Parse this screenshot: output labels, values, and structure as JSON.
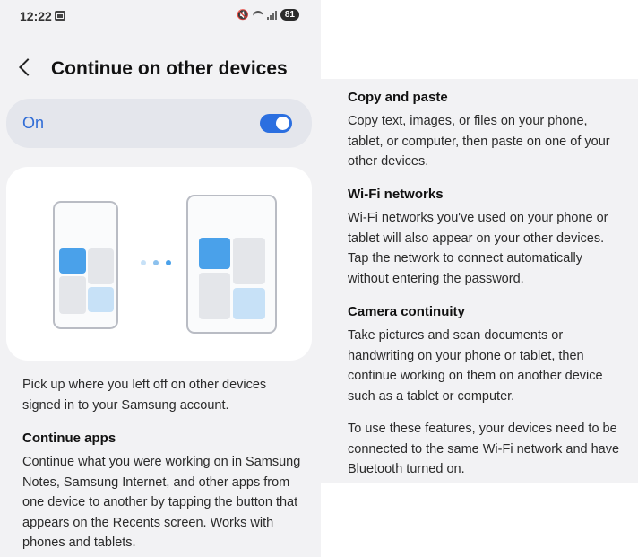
{
  "status_bar": {
    "time": "12:22",
    "battery": "81"
  },
  "header": {
    "title": "Continue on other devices"
  },
  "toggle": {
    "label": "On",
    "state": true
  },
  "illustration": {
    "colors": {
      "accent": "#4aa1ea",
      "accent_light": "#c7e1f7",
      "tile": "#e4e6ea",
      "frame": "#b9bcc4"
    }
  },
  "content": {
    "intro": "Pick up where you left off on other devices signed in to your Samsung account.",
    "sections": [
      {
        "title": "Continue apps",
        "body": "Continue what you were working on in Samsung Notes, Samsung Internet, and other apps from one device to another by tapping the button that appears on the Recents screen. Works with phones and tablets."
      },
      {
        "title": "Copy and paste",
        "body": "Copy text, images, or files on your phone, tablet, or computer, then paste on one of your other devices."
      },
      {
        "title": "Wi-Fi networks",
        "body": "Wi-Fi networks you've used on your phone or tablet will also appear on your other devices. Tap the network to connect automatically without entering the password."
      },
      {
        "title": "Camera continuity",
        "body": "Take pictures and scan documents or handwriting on your phone or tablet, then continue working on them on another device such as a tablet or computer."
      }
    ],
    "footer": "To use these features, your devices need to be connected to the same Wi-Fi network and have Bluetooth turned on."
  },
  "colors": {
    "accent": "#2b6fe0",
    "background": "#f2f2f4"
  }
}
